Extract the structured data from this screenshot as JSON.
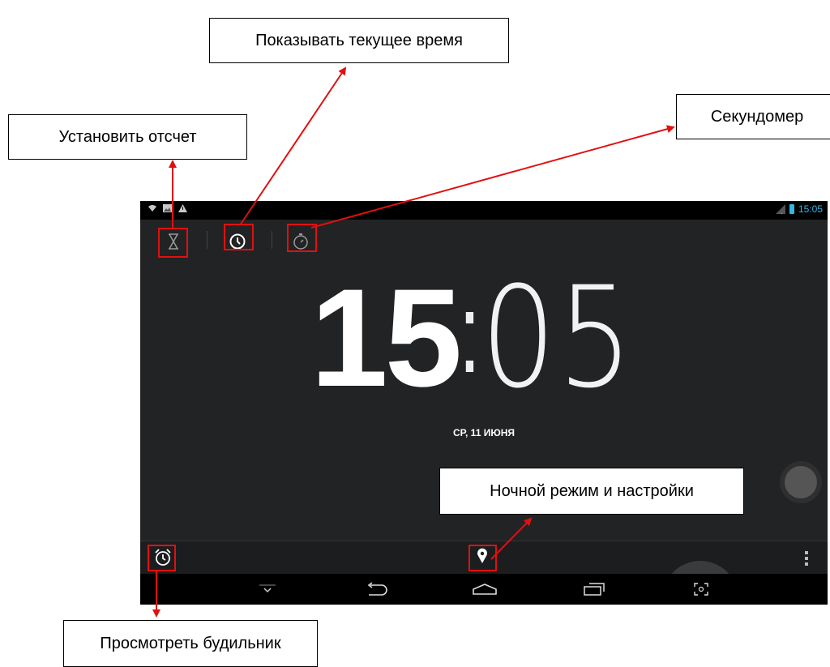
{
  "callouts": {
    "current_time": "Показывать текущее время",
    "stopwatch": "Секундомер",
    "timer": "Установить отсчет",
    "night_mode": "Ночной режим и настройки",
    "alarms": "Просмотреть будильник"
  },
  "status_bar": {
    "time": "15:05"
  },
  "clock": {
    "hours": "15",
    "separator": ":",
    "minutes": "05",
    "date": "СР, 11 ИЮНЯ"
  },
  "colors": {
    "accent": "#33b5e5",
    "annotation": "#e01010",
    "screen_bg": "#222325"
  },
  "icons": {
    "tabs": [
      "hourglass-icon",
      "clock-icon",
      "stopwatch-icon"
    ],
    "bottom": [
      "alarm-icon",
      "night-mode-icon",
      "overflow-menu-icon"
    ],
    "nav": [
      "hide-keyboard-icon",
      "back-icon",
      "home-icon",
      "recent-apps-icon",
      "screenshot-icon"
    ]
  }
}
